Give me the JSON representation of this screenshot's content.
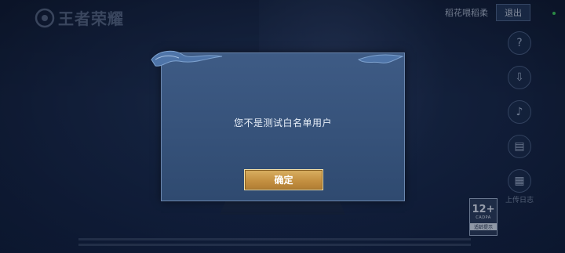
{
  "app": {
    "logo_text": "王者荣耀"
  },
  "topbar": {
    "username": "稻花喂稻柔",
    "logout_label": "退出"
  },
  "side": {
    "help_label": "",
    "upload_log_label": "上传日志"
  },
  "age_rating": {
    "number": "12+",
    "sub": "CADPA",
    "note": "适龄提示"
  },
  "dialog": {
    "message": "您不是测试白名单用户",
    "confirm_label": "确定"
  },
  "colors": {
    "accent_gold": "#c49041",
    "dialog_bg": "#3e5b85",
    "status_dot": "#3fd05a"
  }
}
